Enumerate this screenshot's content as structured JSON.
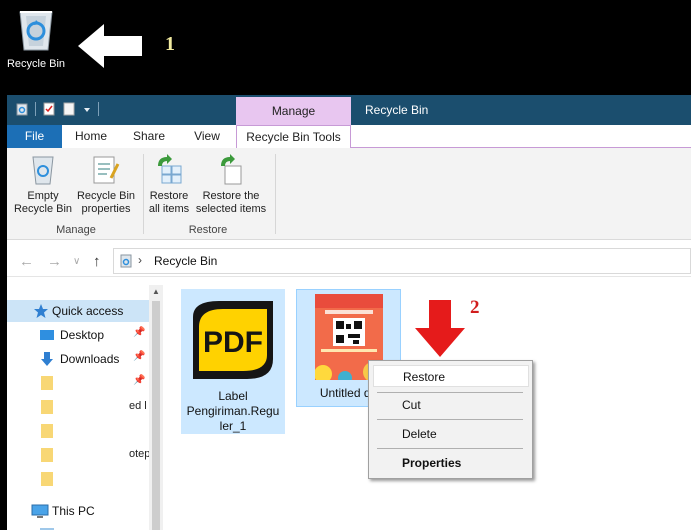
{
  "desktop": {
    "recycle_bin_label": "Recycle Bin",
    "step1": "1",
    "step2": "2"
  },
  "window": {
    "context_tab_group": "Manage",
    "title": "Recycle Bin",
    "tabs": [
      "File",
      "Home",
      "Share",
      "View",
      "Recycle Bin Tools"
    ],
    "ribbon": {
      "empty_recycle_bin": [
        "Empty",
        "Recycle Bin"
      ],
      "recycle_bin_properties": [
        "Recycle Bin",
        "properties"
      ],
      "restore_all_items": [
        "Restore",
        "all items"
      ],
      "restore_selected_items": [
        "Restore the",
        "selected items"
      ],
      "group_manage": "Manage",
      "group_restore": "Restore"
    },
    "address": {
      "path": "Recycle Bin"
    },
    "nav": {
      "quick_access": "Quick access",
      "desktop": "Desktop",
      "downloads": "Downloads",
      "this_pc": "This PC",
      "clipped_1": "ed l",
      "clipped_2": "otep"
    },
    "files": [
      {
        "name_lines": [
          "Label",
          "Pengiriman.Regu",
          "ler_1"
        ]
      },
      {
        "name_lines": [
          "Untitled de"
        ]
      }
    ],
    "context_menu": {
      "restore": "Restore",
      "cut": "Cut",
      "delete": "Delete",
      "properties": "Properties"
    }
  },
  "colors": {
    "titlebar": "#1b4e6e",
    "file_tab": "#1c6fb6",
    "context_tab": "#e8c6f0",
    "selection": "#cce8ff",
    "annotation_red": "#d11d1d"
  }
}
